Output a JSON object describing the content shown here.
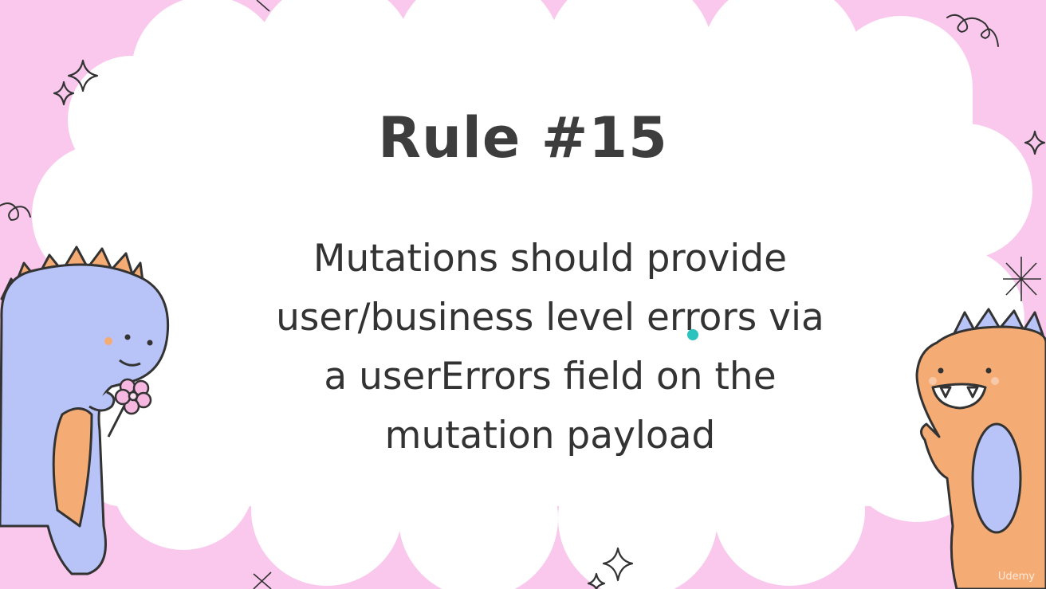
{
  "slide": {
    "title": "Rule #15",
    "lines": [
      "Mutations should provide",
      "user/business level errors via",
      "a userErrors field on the",
      "mutation payload"
    ]
  },
  "watermark": "Udemy",
  "colors": {
    "background": "#f9c8ec",
    "cloud": "#ffffff",
    "text": "#333333",
    "dino_blue": "#b8c3f7",
    "dino_orange": "#f5ac74",
    "cursor": "#2cc3bf"
  },
  "decorations": [
    "sparkle-icon",
    "flower-icon",
    "swirl-icon"
  ]
}
